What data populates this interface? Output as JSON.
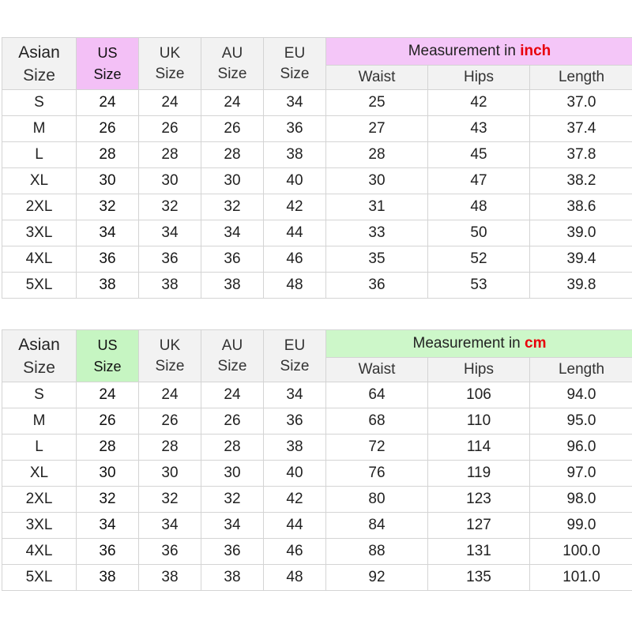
{
  "headers": {
    "asian": [
      "Asian",
      "Size"
    ],
    "us": [
      "US",
      "Size"
    ],
    "uk": [
      "UK",
      "Size"
    ],
    "au": [
      "AU",
      "Size"
    ],
    "eu": [
      "EU",
      "Size"
    ],
    "waist": "Waist",
    "hips": "Hips",
    "length": "Length",
    "measurement_prefix": "Measurement in "
  },
  "colors": {
    "inch_header": "#f4c6f8",
    "cm_header": "#cdf7c9",
    "unit_text": "#e8000b"
  },
  "tables": [
    {
      "unit": "inch",
      "rows": [
        [
          "S",
          "24",
          "24",
          "24",
          "34",
          "25",
          "42",
          "37.0"
        ],
        [
          "M",
          "26",
          "26",
          "26",
          "36",
          "27",
          "43",
          "37.4"
        ],
        [
          "L",
          "28",
          "28",
          "28",
          "38",
          "28",
          "45",
          "37.8"
        ],
        [
          "XL",
          "30",
          "30",
          "30",
          "40",
          "30",
          "47",
          "38.2"
        ],
        [
          "2XL",
          "32",
          "32",
          "32",
          "42",
          "31",
          "48",
          "38.6"
        ],
        [
          "3XL",
          "34",
          "34",
          "34",
          "44",
          "33",
          "50",
          "39.0"
        ],
        [
          "4XL",
          "36",
          "36",
          "36",
          "46",
          "35",
          "52",
          "39.4"
        ],
        [
          "5XL",
          "38",
          "38",
          "38",
          "48",
          "36",
          "53",
          "39.8"
        ]
      ]
    },
    {
      "unit": "cm",
      "rows": [
        [
          "S",
          "24",
          "24",
          "24",
          "34",
          "64",
          "106",
          "94.0"
        ],
        [
          "M",
          "26",
          "26",
          "26",
          "36",
          "68",
          "110",
          "95.0"
        ],
        [
          "L",
          "28",
          "28",
          "28",
          "38",
          "72",
          "114",
          "96.0"
        ],
        [
          "XL",
          "30",
          "30",
          "30",
          "40",
          "76",
          "119",
          "97.0"
        ],
        [
          "2XL",
          "32",
          "32",
          "32",
          "42",
          "80",
          "123",
          "98.0"
        ],
        [
          "3XL",
          "34",
          "34",
          "34",
          "44",
          "84",
          "127",
          "99.0"
        ],
        [
          "4XL",
          "36",
          "36",
          "36",
          "46",
          "88",
          "131",
          "100.0"
        ],
        [
          "5XL",
          "38",
          "38",
          "38",
          "48",
          "92",
          "135",
          "101.0"
        ]
      ]
    }
  ]
}
